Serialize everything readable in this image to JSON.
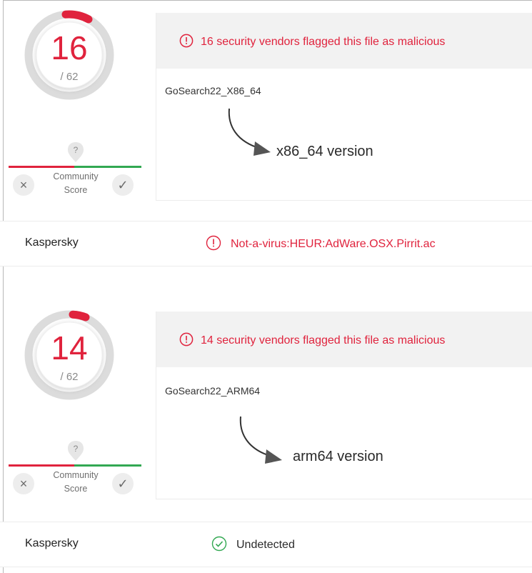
{
  "reports": [
    {
      "score": "16",
      "total": "/ 62",
      "score_fraction": 0.258,
      "alert_text": "16 security vendors flagged this file as malicious",
      "filename": "GoSearch22_X86_64",
      "version_label": "x86_64 version",
      "community": {
        "label_line1": "Community",
        "label_line2": "Score",
        "question": "?",
        "down": "×",
        "up": "✓"
      },
      "engine": "Kaspersky",
      "result": "Not-a-virus:HEUR:AdWare.OSX.Pirrit.ac",
      "result_status": "malicious"
    },
    {
      "score": "14",
      "total": "/ 62",
      "score_fraction": 0.226,
      "alert_text": "14 security vendors flagged this file as malicious",
      "filename": "GoSearch22_ARM64",
      "version_label": "arm64 version",
      "community": {
        "label_line1": "Community",
        "label_line2": "Score",
        "question": "?",
        "down": "×",
        "up": "✓"
      },
      "engine": "Kaspersky",
      "result": "Undetected",
      "result_status": "undetected"
    }
  ],
  "colors": {
    "malicious": "#e0233d",
    "clean": "#32a852",
    "gauge_track": "#dcdcdc"
  },
  "icons": {
    "alert": "exclamation-circle-icon",
    "undetected": "check-circle-icon",
    "help": "question-badge-icon"
  }
}
